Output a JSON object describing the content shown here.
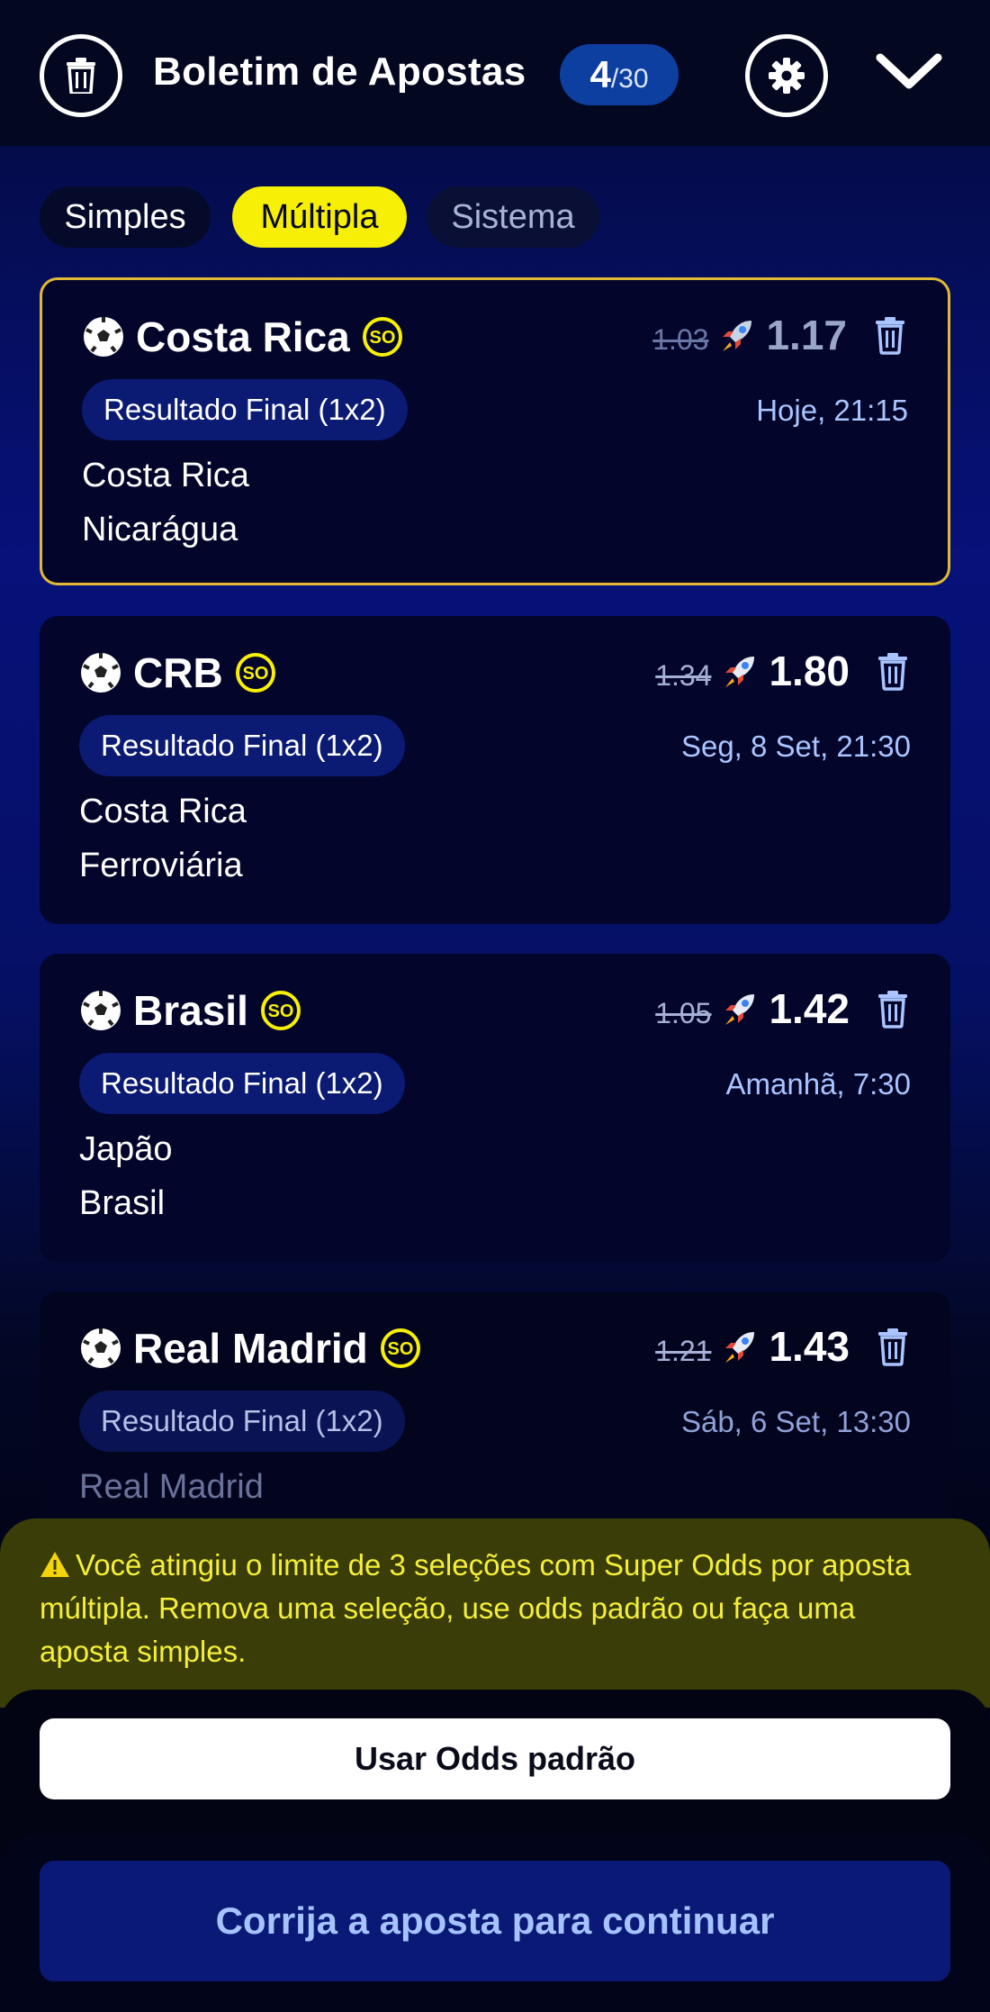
{
  "header": {
    "title": "Boletim de Apostas",
    "count": "4",
    "max": "/30",
    "icons": {
      "clear": "trash-icon",
      "settings": "gear-icon",
      "collapse": "chevron-down-icon"
    }
  },
  "tabs": [
    {
      "label": "Simples",
      "active": false
    },
    {
      "label": "Múltipla",
      "active": true
    },
    {
      "label": "Sistema",
      "active": false
    }
  ],
  "selections": [
    {
      "team": "Costa Rica",
      "badge": "SO",
      "old_odd": "1.03",
      "new_odd": "1.17",
      "market": "Resultado Final (1x2)",
      "date": "Hoje, 21:15",
      "home": "Costa Rica",
      "away": "Nicarágua"
    },
    {
      "team": "CRB",
      "badge": "SO",
      "old_odd": "1.34",
      "new_odd": "1.80",
      "market": "Resultado Final (1x2)",
      "date": "Seg, 8 Set, 21:30",
      "home": "Costa Rica",
      "away": "Ferroviária"
    },
    {
      "team": "Brasil",
      "badge": "SO",
      "old_odd": "1.05",
      "new_odd": "1.42",
      "market": "Resultado Final (1x2)",
      "date": "Amanhã, 7:30",
      "home": "Japão",
      "away": "Brasil"
    },
    {
      "team": "Real Madrid",
      "badge": "SO",
      "old_odd": "1.21",
      "new_odd": "1.43",
      "market": "Resultado Final (1x2)",
      "date": "Sáb, 6 Set, 13:30",
      "home": "Real Madrid"
    }
  ],
  "warning": {
    "text": "Você atingiu o limite de 3 seleções com Super Odds por aposta múltipla. Remova uma seleção, use odds padrão ou faça uma aposta simples."
  },
  "actions": {
    "standard_odds": "Usar Odds padrão",
    "fix_bet": "Corrija a aposta para continuar"
  },
  "colors": {
    "accent_yellow": "#f7ef05",
    "selected_border": "#e1b935",
    "market_pill": "#0b1a73",
    "counter_badge": "#0c3fa0",
    "warning_bg": "#3a3d07",
    "fix_button": "#0b1976"
  }
}
